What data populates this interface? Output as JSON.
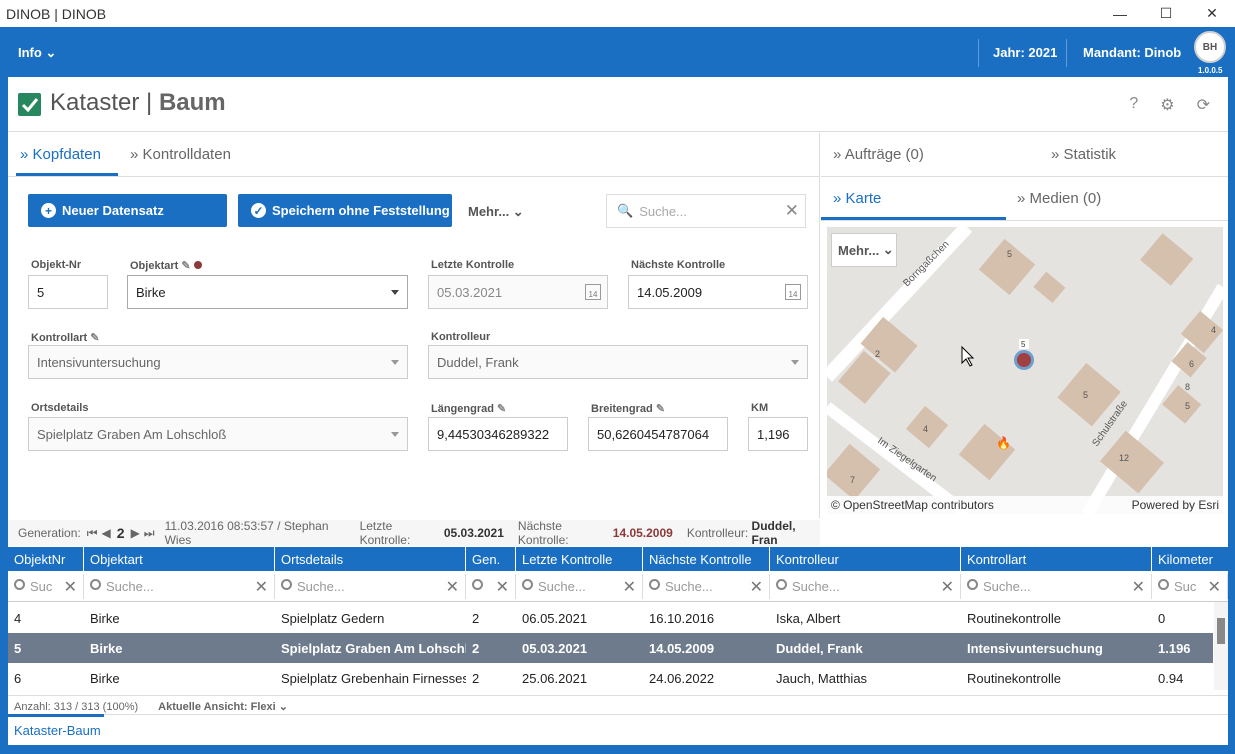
{
  "window": {
    "title": "DINOB | DINOB"
  },
  "topbar": {
    "info": "Info",
    "jahr": "Jahr: 2021",
    "mandant": "Mandant: Dinob",
    "avatar": "BH",
    "version": "1.0.0.5"
  },
  "header": {
    "title_light": "Kataster |",
    "title_bold": "Baum"
  },
  "tabs": {
    "kopfdaten": "Kopfdaten",
    "kontrolldaten": "Kontrolldaten"
  },
  "right_tabs": {
    "auftraege": "Aufträge (0)",
    "statistik": "Statistik",
    "karte": "Karte",
    "medien": "Medien (0)"
  },
  "toolbar": {
    "new": "Neuer Datensatz",
    "save": "Speichern ohne Feststellung",
    "mehr": "Mehr...",
    "search_placeholder": "Suche..."
  },
  "form": {
    "objekt_nr_label": "Objekt-Nr",
    "objekt_nr": "5",
    "objektart_label": "Objektart",
    "objektart": "Birke",
    "letzte_label": "Letzte Kontrolle",
    "letzte": "05.03.2021",
    "naechste_label": "Nächste Kontrolle",
    "naechste": "14.05.2009",
    "kontrollart_label": "Kontrollart",
    "kontrollart": "Intensivuntersuchung",
    "kontrolleur_label": "Kontrolleur",
    "kontrolleur": "Duddel, Frank",
    "ortsdetails_label": "Ortsdetails",
    "ortsdetails": "Spielplatz Graben  Am Lohschloß",
    "laengengrad_label": "Längengrad",
    "laengengrad": "9,44530346289322",
    "breitengrad_label": "Breitengrad",
    "breitengrad": "50,6260454787064",
    "km_label": "KM",
    "km": "1,196"
  },
  "map": {
    "mehr": "Mehr...",
    "attribution": "© OpenStreetMap contributors",
    "powered": "Powered by Esri",
    "marker": "5",
    "streets": [
      "Borngaßchen",
      "Schulstraße",
      "Im Ziegelgarten"
    ],
    "numbers": [
      "5",
      "2",
      "4",
      "5",
      "4",
      "6",
      "8",
      "5",
      "12",
      "7"
    ]
  },
  "genbar": {
    "generation_label": "Generation:",
    "generation": "2",
    "info": "11.03.2016 08:53:57 / Stephan Wies",
    "letzte_label": "Letzte Kontrolle:",
    "letzte": "05.03.2021",
    "naechste_label": "Nächste Kontrolle:",
    "naechste": "14.05.2009",
    "kontrolleur_label": "Kontrolleur:",
    "kontrolleur": "Duddel, Fran"
  },
  "grid": {
    "columns": [
      "ObjektNr",
      "Objektart",
      "Ortsdetails",
      "Gen.",
      "Letzte Kontrolle",
      "Nächste Kontrolle",
      "Kontrolleur",
      "Kontrollart",
      "Kilometer"
    ],
    "filter_short": "Suc",
    "filter": "Suche...",
    "rows": [
      [
        "4",
        "Birke",
        "Spielplatz Gedern",
        "2",
        "06.05.2021",
        "16.10.2016",
        "Iska, Albert",
        "Routinekontrolle",
        "0"
      ],
      [
        "5",
        "Birke",
        "Spielplatz Graben  Am Lohschloß",
        "2",
        "05.03.2021",
        "14.05.2009",
        "Duddel, Frank",
        "Intensivuntersuchung",
        "1.196"
      ],
      [
        "6",
        "Birke",
        "Spielplatz Grebenhain  Firnesses",
        "2",
        "25.06.2021",
        "24.06.2022",
        "Jauch, Matthias",
        "Routinekontrolle",
        "0.94"
      ]
    ]
  },
  "footer": {
    "count": "Anzahl: 313 / 313 (100%)",
    "view": "Aktuelle Ansicht: Flexi"
  },
  "bottom_tab": "Kataster-Baum"
}
